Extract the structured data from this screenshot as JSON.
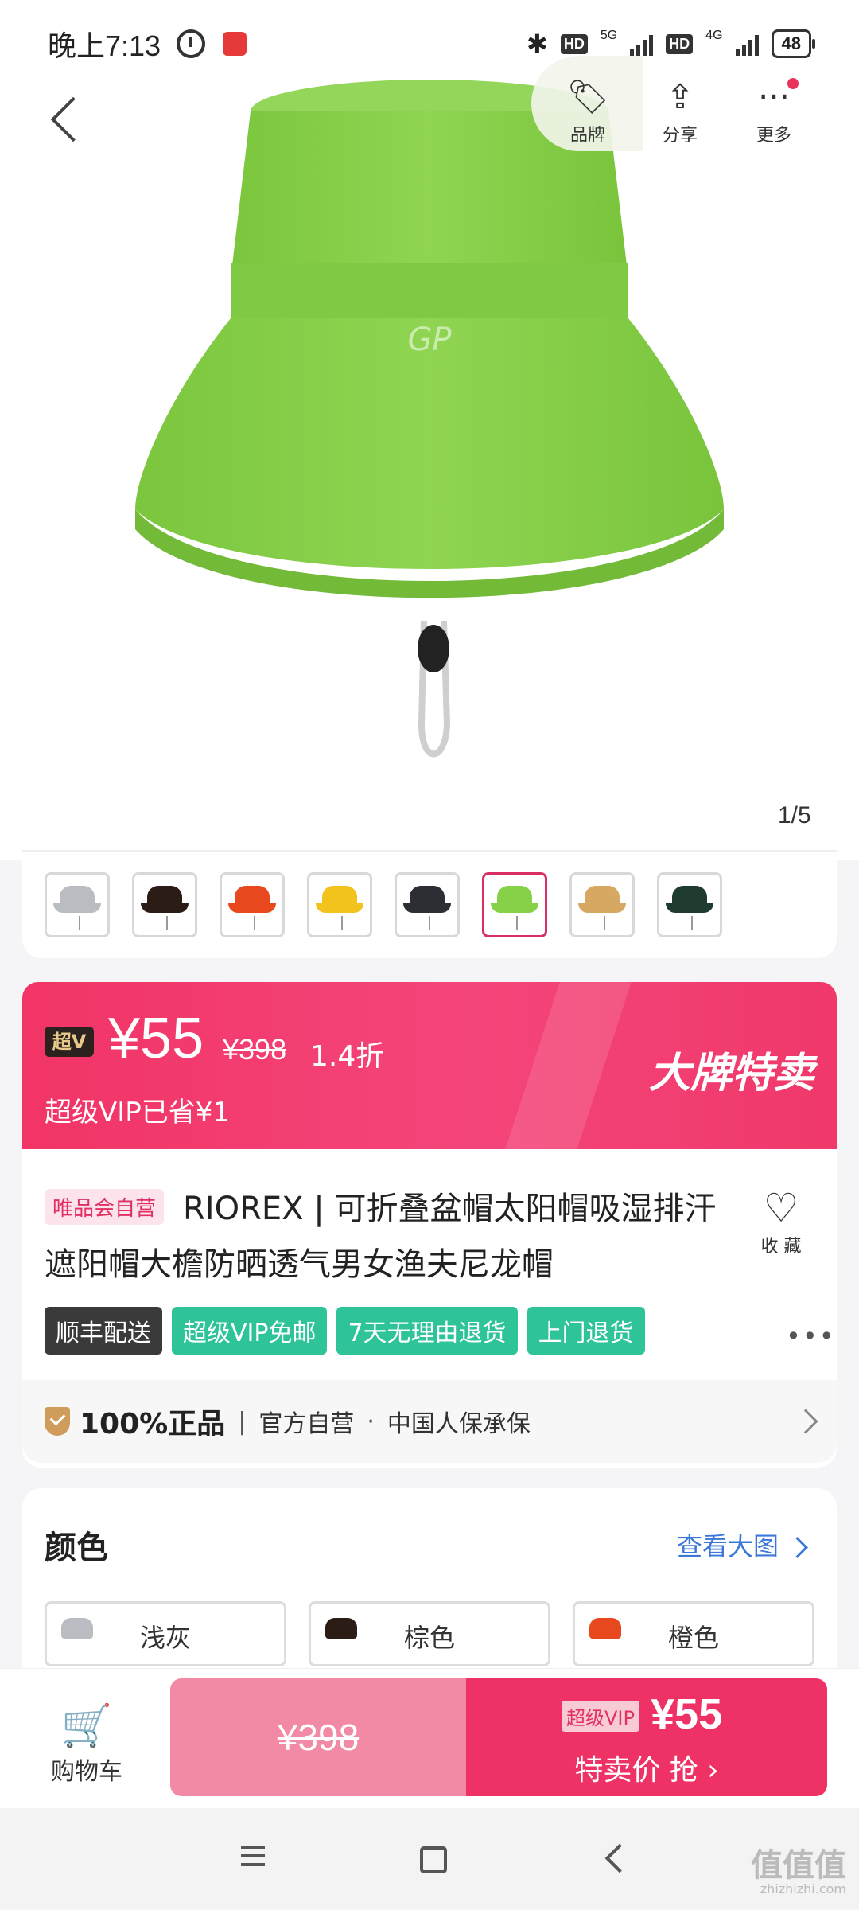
{
  "status_bar": {
    "time": "晚上7:13",
    "hd1": "HD",
    "net1": "5G",
    "hd2": "HD",
    "net2": "4G",
    "battery": "48"
  },
  "header": {
    "brand_label": "品牌",
    "share_label": "分享",
    "more_label": "更多"
  },
  "gallery": {
    "pager": "1/5"
  },
  "thumbnails": [
    {
      "color": "#b9bcc0",
      "selected": false
    },
    {
      "color": "#2b1c16",
      "selected": false
    },
    {
      "color": "#e8481e",
      "selected": false
    },
    {
      "color": "#f2c31c",
      "selected": false
    },
    {
      "color": "#2c2e33",
      "selected": false
    },
    {
      "color": "#86d148",
      "selected": true
    },
    {
      "color": "#d6a862",
      "selected": false
    },
    {
      "color": "#1f3a2f",
      "selected": false
    }
  ],
  "price": {
    "vip_badge": "超V",
    "current": "¥55",
    "original": "¥398",
    "discount": "1.4折",
    "saved": "超级VIP已省¥1",
    "promo": "大牌特卖"
  },
  "product": {
    "self_tag": "唯品会自营",
    "title": "RIOREX | 可折叠盆帽太阳帽吸湿排汗遮阳帽大檐防晒透气男女渔夫尼龙帽",
    "favorite_label": "收 藏",
    "tags": [
      "顺丰配送",
      "超级VIP免邮",
      "7天无理由退货",
      "上门退货"
    ],
    "more": "•••"
  },
  "guarantee": {
    "strong": "100%正品",
    "divider": "|",
    "official": "官方自营",
    "dot": "·",
    "insurer": "中国人保承保"
  },
  "colors": {
    "title": "颜色",
    "view_big": "查看大图",
    "options": [
      {
        "label": "浅灰",
        "color": "#b9bcc0"
      },
      {
        "label": "棕色",
        "color": "#2b1c16"
      },
      {
        "label": "橙色",
        "color": "#e8481e"
      }
    ]
  },
  "bottom": {
    "cart_label": "购物车",
    "orig_price": "¥398",
    "vip_tag": "超级VIP",
    "buy_price": "¥55",
    "buy_label": "特卖价 抢 ›"
  },
  "watermark": {
    "main": "值值值",
    "sub": "zhizhizhi.com"
  },
  "accent": {
    "brand_pink": "#ee3266",
    "link_blue": "#3a77d8",
    "teal_tag": "#2fc39a",
    "hat_green": "#86d148"
  }
}
